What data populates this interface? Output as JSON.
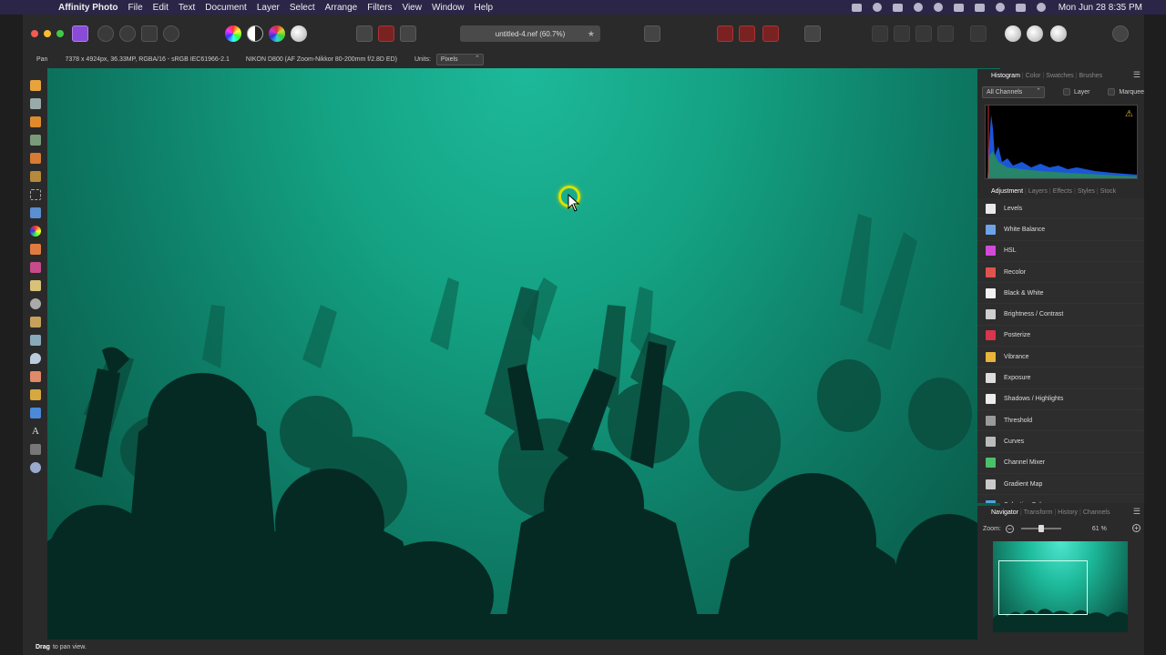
{
  "menubar": {
    "apple_icon": "apple-icon",
    "app_name": "Affinity Photo",
    "items": [
      "File",
      "Edit",
      "Text",
      "Document",
      "Layer",
      "Select",
      "Arrange",
      "Filters",
      "View",
      "Window",
      "Help"
    ],
    "clock": "Mon Jun 28  8:35 PM"
  },
  "toolbar": {
    "document_tab": "untitled-4.nef (60.7%)",
    "tab_star": "★"
  },
  "context": {
    "tool_name": "Pan",
    "image_info": "7378 x 4924px, 36.33MP, RGBA/16 - sRGB IEC61966-2.1",
    "camera_info": "NIKON D800 (AF Zoom-Nikkor 80-200mm f/2.8D ED)",
    "units_label": "Units:",
    "units_value": "Pixels"
  },
  "histogram_panel": {
    "tabs": [
      "Histogram",
      "Color",
      "Swatches",
      "Brushes"
    ],
    "channel_select": "All Channels",
    "layer_label": "Layer",
    "marquee_label": "Marquee",
    "warning_icon": "⚠"
  },
  "adjustment_panel": {
    "tabs": [
      "Adjustment",
      "Layers",
      "Effects",
      "Styles",
      "Stock"
    ],
    "items": [
      {
        "label": "Levels",
        "color": "#e9e9e9"
      },
      {
        "label": "White Balance",
        "color": "#6ea3e8"
      },
      {
        "label": "HSL",
        "color": "#d24bd8"
      },
      {
        "label": "Recolor",
        "color": "#e0534f"
      },
      {
        "label": "Black & White",
        "color": "#f2f2f2"
      },
      {
        "label": "Brightness / Contrast",
        "color": "#cfcfcf"
      },
      {
        "label": "Posterize",
        "color": "#d8364c"
      },
      {
        "label": "Vibrance",
        "color": "#e8b43a"
      },
      {
        "label": "Exposure",
        "color": "#dddddd"
      },
      {
        "label": "Shadows / Highlights",
        "color": "#ececec"
      },
      {
        "label": "Threshold",
        "color": "#9a9a9a"
      },
      {
        "label": "Curves",
        "color": "#bbbbbb"
      },
      {
        "label": "Channel Mixer",
        "color": "#4bc06a"
      },
      {
        "label": "Gradient Map",
        "color": "#c9c9c9"
      },
      {
        "label": "Selective Color",
        "color": "#4fa3e0"
      }
    ]
  },
  "navigator_panel": {
    "tabs": [
      "Navigator",
      "Transform",
      "History",
      "Channels"
    ],
    "zoom_label": "Zoom:",
    "zoom_value": "61 %",
    "zoom_minus": "−",
    "zoom_plus": "+",
    "zoom_fraction": 0.5
  },
  "statusbar": {
    "bold": "Drag",
    "text": "to pan view."
  },
  "colors": {
    "accent_purple": "#8a4bd6",
    "cursor_ring": "#d8e200",
    "canvas_teal": "#14a283"
  }
}
